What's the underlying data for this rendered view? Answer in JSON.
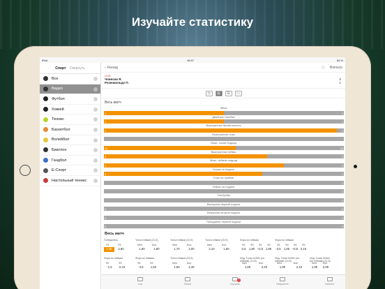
{
  "headline": "Изучайте статистику",
  "status": {
    "device": "iPad",
    "time": "16:47",
    "battery": "64 %"
  },
  "sidebar": {
    "title": "Спорт",
    "collapse": "Свернуть",
    "items": [
      {
        "label": "Все",
        "icon": "all-sports-icon",
        "color": "#333333"
      },
      {
        "label": "Видео",
        "icon": "video-icon",
        "color": "#333333"
      },
      {
        "label": "Футбол",
        "icon": "soccer-ball-icon",
        "color": "#222222"
      },
      {
        "label": "Хоккей",
        "icon": "hockey-puck-icon",
        "color": "#222222"
      },
      {
        "label": "Теннис",
        "icon": "tennis-ball-icon",
        "color": "#bcd22d"
      },
      {
        "label": "Баскетбол",
        "icon": "basketball-icon",
        "color": "#e58a2e"
      },
      {
        "label": "Волейбол",
        "icon": "volleyball-icon",
        "color": "#e8c53a"
      },
      {
        "label": "Биатлон",
        "icon": "biathlon-icon",
        "color": "#333333"
      },
      {
        "label": "Гандбол",
        "icon": "handball-icon",
        "color": "#3a6fc9"
      },
      {
        "label": "Е-Спорт",
        "icon": "esport-icon",
        "color": "#555555"
      },
      {
        "label": "Настольный теннис",
        "icon": "table-tennis-icon",
        "color": "#c83a3a"
      }
    ]
  },
  "nav": {
    "back": "Назад",
    "filter": "Фильтр"
  },
  "match": {
    "live": "LIVE",
    "player1": "Чоински Я.",
    "player2": "Розенкильде П.",
    "score1": "0",
    "score2": "0",
    "set1": "0",
    "set2": "1"
  },
  "period": "Весь матч",
  "stats": [
    {
      "label": "Эйсы",
      "v1": "1",
      "v2": "1",
      "pct": 0.5
    },
    {
      "label": "Двойные Ошибки",
      "v1": "1",
      "v2": "1",
      "pct": 0.5
    },
    {
      "label": "Выигранные брейк-поинты",
      "v1": "1",
      "v2": "2",
      "pct": 0.97
    },
    {
      "label": "Выигранные очки",
      "v1": "",
      "v2": "",
      "pct": 0.0
    },
    {
      "label": "Макс. очков подряд",
      "v1": "24",
      "v2": "16",
      "pct": 0.55
    },
    {
      "label": "Выигранные геймы",
      "v1": "3",
      "v2": "2",
      "pct": 0.68
    },
    {
      "label": "Макс. геймов подряд",
      "v1": "1",
      "v2": "1",
      "pct": 0.75
    },
    {
      "label": "Очков на подаче",
      "v1": "3",
      "v2": "1",
      "pct": 0.66
    },
    {
      "label": "Очки на приёме",
      "v1": "",
      "v2": "1",
      "pct": 0.0
    },
    {
      "label": "Геймы на подаче",
      "v1": "",
      "v2": "1",
      "pct": 0.0
    },
    {
      "label": "Тай-брейк",
      "v1": "",
      "v2": "1",
      "pct": 0.0
    },
    {
      "label": "Выиграны первой подачи",
      "v1": "0",
      "v2": "0",
      "pct": 0.0
    },
    {
      "label": "Выиграны второй подачи",
      "v1": "0",
      "v2": "0",
      "pct": 0.0
    },
    {
      "label": "Попадание первой подачи",
      "v1": "0",
      "v2": "0",
      "pct": 0.0
    }
  ],
  "whole_match": "Весь матч",
  "markets": {
    "winner": "Победитель",
    "winner_c": [
      "П1",
      "П2"
    ],
    "winner_v": [
      "1,35",
      "2,90"
    ],
    "total_a": "Тотал геймов (21,5)",
    "total_a_c": [
      "Мен",
      "Бол"
    ],
    "total_a_v": [
      "1,90",
      "1,80"
    ],
    "total_b": "Тотал геймов (22,5)",
    "total_b_c": [
      "Мен",
      "Бол"
    ],
    "total_b_v": [
      "1,70",
      "2,00"
    ],
    "total_c": "Тотал геймов (20,5)",
    "total_c_c": [
      "Мен",
      "Бол"
    ],
    "total_c_v": [
      "2,10",
      "1,60"
    ],
    "total_d": "Тотал геймов (23,5)",
    "total_d_c": [
      "Мен",
      "Бол"
    ],
    "total_d_v": [
      "1,50",
      "2,45"
    ],
    "fora_a": "Фора по геймам",
    "fora_a_c": [
      "Ф1",
      "Ф2",
      "Ф1",
      "Ф2"
    ],
    "fora_a_v": [
      "-2,5",
      "1,80",
      "+2,5",
      "1,85"
    ],
    "fora_b": "Фора по геймам",
    "fora_b_c": [
      "Ф1",
      "Ф2",
      "Ф1",
      "Ф2"
    ],
    "fora_b_v": [
      "-3,5",
      "1,65",
      "+3,5",
      "2,15"
    ],
    "fora_c": "Фора по геймам",
    "fora_c_c": [
      "Ф1",
      "Ф2"
    ],
    "fora_c_v": [
      "-1,5",
      "2,10"
    ],
    "fora_d": "Фора по геймам",
    "fora_d_c": [
      "Ф1",
      "Ф2"
    ],
    "fora_d_v": [
      "-4,5",
      "1,50"
    ],
    "ind_a": "Инд. Тотал КОМ1 (по геймам) (11,5)",
    "ind_a_c": [
      "Мен",
      "Бол"
    ],
    "ind_a_v": [
      "1,95",
      "2,95"
    ],
    "ind_b": "Инд. Тотал КОМ1 (по геймам) (13,5)",
    "ind_b_c": [
      "Мен",
      "Бол"
    ],
    "ind_b_v": [
      "1,65",
      "2,20"
    ],
    "ind_c": "Инд. Тотал КОМ1 (по геймам) (14,5)",
    "ind_c_c": [
      "Мен",
      "Бол"
    ],
    "ind_c_v": [
      "1,85",
      "2,10"
    ]
  },
  "tabbar": [
    {
      "label": "Live",
      "icon": "live-icon"
    },
    {
      "label": "Линия",
      "icon": "line-icon"
    },
    {
      "label": "Корзина",
      "icon": "basket-icon",
      "badge": "1"
    },
    {
      "label": "Избранное",
      "icon": "favorites-icon"
    },
    {
      "label": "Кабинет",
      "icon": "account-icon"
    }
  ]
}
